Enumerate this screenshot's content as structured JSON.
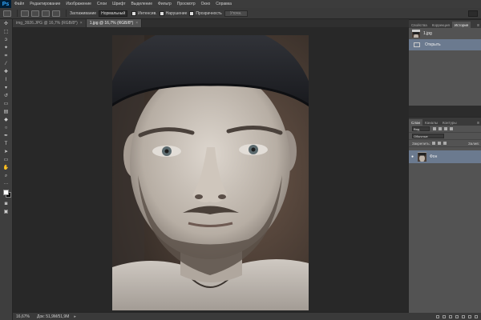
{
  "app": {
    "logo": "Ps"
  },
  "menu": [
    "Файл",
    "Редактирование",
    "Изображение",
    "Слои",
    "Шрифт",
    "Выделение",
    "Фильтр",
    "Просмотр",
    "Окно",
    "Справка"
  ],
  "options": {
    "width_label": "Заглаживание",
    "width_value": "Нормальный",
    "check_1": "Интенсив.",
    "check_2": "Нарушение",
    "check_3": "Прозрачность",
    "refine_button": "Уточн."
  },
  "document": {
    "tab_1": "img_3926.JPG @ 16,7% (RGB/8*)",
    "tab_2": "1.jpg @ 16,7% (RGB/8*)",
    "close": "×"
  },
  "status": {
    "zoom": "16,67%",
    "doc_info": "Док: 51,9M/51,9M",
    "arrow": "▸"
  },
  "history_panel": {
    "tabs": [
      "Свойства",
      "Коррекция",
      "История"
    ],
    "menu": "≡",
    "items": [
      {
        "label": "1.jpg"
      },
      {
        "label": "Открыть"
      }
    ]
  },
  "layers_panel": {
    "tabs": [
      "Слои",
      "Каналы",
      "Контуры"
    ],
    "menu": "≡",
    "filter": "Вид",
    "blend_mode": "Обычные",
    "lock_label": "Закрепить:",
    "fill_label": "Залив:",
    "layer_name": "Фон",
    "eye": "●"
  },
  "colors": {
    "accent": "#31a8ff",
    "selected_row": "#6b7a8f",
    "canvas_bg": "#282828"
  }
}
